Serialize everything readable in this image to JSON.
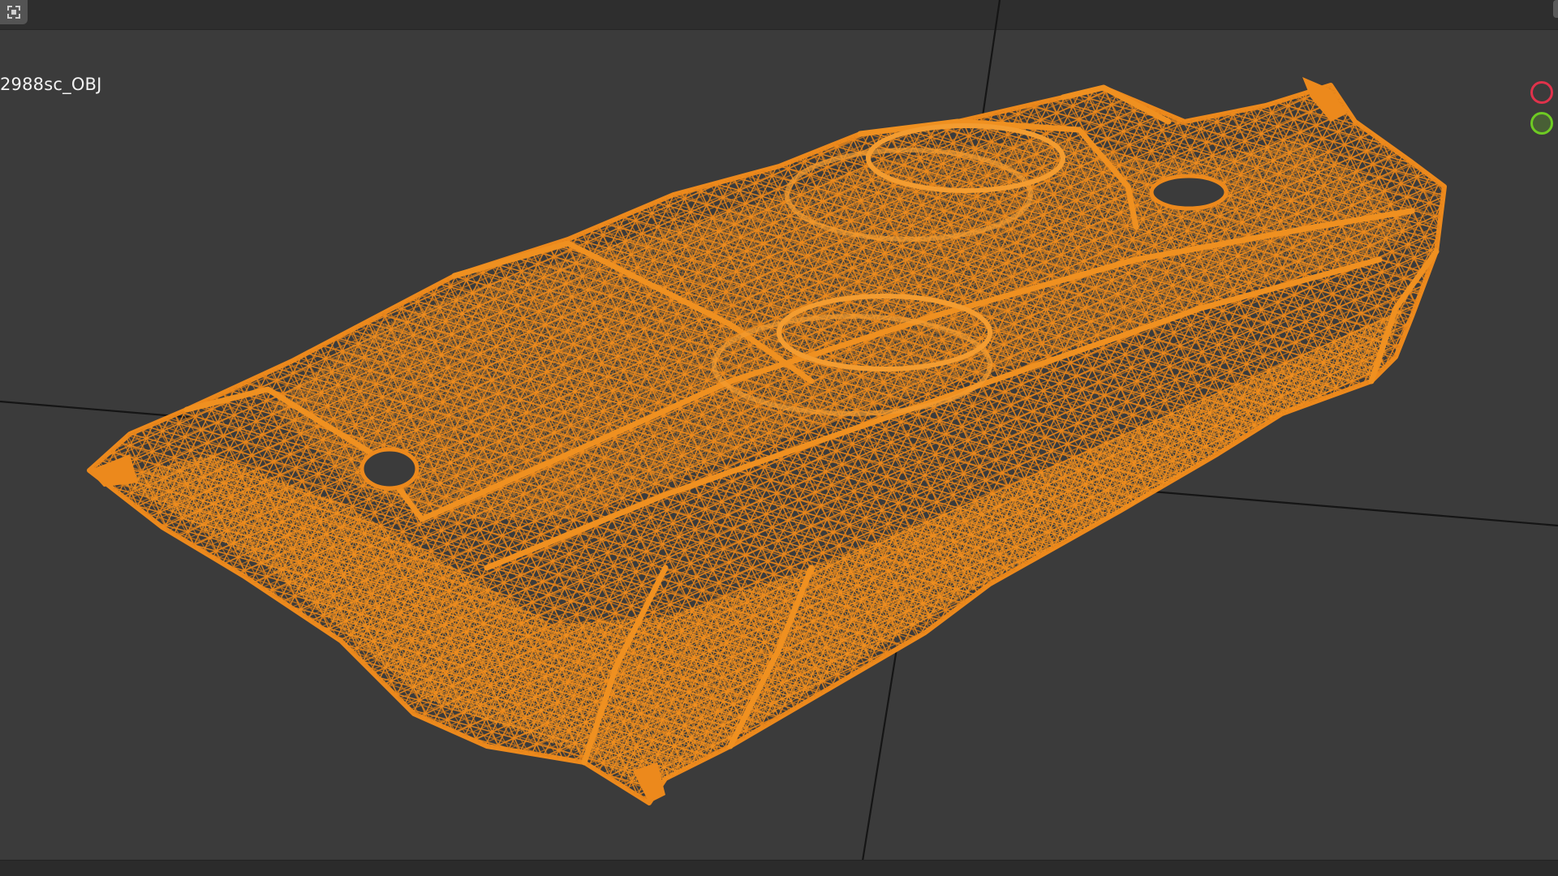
{
  "viewport": {
    "object_name": "2988sc_OBJ",
    "display_mode": "wireframe",
    "background_color": "#3b3b3b",
    "wireframe_color": "#f28c1c",
    "grid_line_color": "#1a1a1a"
  },
  "toolbar": {
    "select_tool_icon": "select-box-icon"
  },
  "navigation_gizmo": {
    "x_axis": {
      "icon": "axis-x-circle",
      "color": "#e0324b"
    },
    "y_axis": {
      "icon": "axis-y-circle",
      "color": "#6ecb23"
    }
  }
}
